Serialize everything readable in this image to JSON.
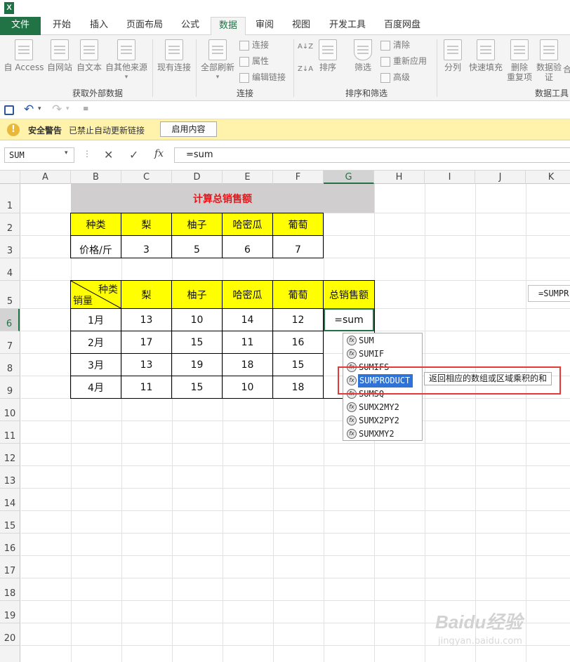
{
  "app": {
    "icon_letter": "X"
  },
  "tabs": [
    "文件",
    "开始",
    "插入",
    "页面布局",
    "公式",
    "数据",
    "审阅",
    "视图",
    "开发工具",
    "百度网盘"
  ],
  "ribbon": {
    "ext_data": [
      "自 Access",
      "自网站",
      "自文本",
      "自其他来源"
    ],
    "existing": "现有连接",
    "refresh_all": "全部刷新",
    "conn_small": [
      "连接",
      "属性",
      "编辑链接"
    ],
    "sort_az": "A↓Z",
    "sort_za": "Z↓A",
    "sort": "排序",
    "filter": "筛选",
    "filter_small": [
      "清除",
      "重新应用",
      "高级"
    ],
    "tools": [
      "分列",
      "快速填充",
      "删除",
      "重复项",
      "数据验",
      "证",
      "合"
    ],
    "groups": [
      "获取外部数据",
      "连接",
      "排序和筛选",
      "数据工具"
    ]
  },
  "security": {
    "title": "安全警告",
    "text": "已禁止自动更新链接",
    "button": "启用内容"
  },
  "formula_bar": {
    "name_box": "SUM",
    "fx": "fx",
    "value": "=sum"
  },
  "columns": [
    "A",
    "B",
    "C",
    "D",
    "E",
    "F",
    "G",
    "H",
    "I",
    "J",
    "K"
  ],
  "rows": [
    "1",
    "2",
    "3",
    "4",
    "5",
    "6",
    "7",
    "8",
    "9",
    "10",
    "11",
    "12",
    "13",
    "14",
    "15",
    "16",
    "17",
    "18",
    "19",
    "20"
  ],
  "sheet": {
    "title": "计算总销售额",
    "price_header": [
      "种类",
      "梨",
      "柚子",
      "哈密瓜",
      "葡萄"
    ],
    "price_row": [
      "价格/斤",
      "3",
      "5",
      "6",
      "7"
    ],
    "sales_header_top": "种类",
    "sales_header_bottom": "销量",
    "sales_header": [
      "梨",
      "柚子",
      "哈密瓜",
      "葡萄",
      "总销售额"
    ],
    "sales_rows": [
      [
        "1月",
        "13",
        "10",
        "14",
        "12",
        "=sum"
      ],
      [
        "2月",
        "17",
        "15",
        "11",
        "16",
        ""
      ],
      [
        "3月",
        "13",
        "19",
        "18",
        "15",
        ""
      ],
      [
        "4月",
        "11",
        "15",
        "10",
        "18",
        ""
      ]
    ]
  },
  "autocomplete": {
    "items": [
      "SUM",
      "SUMIF",
      "SUMIFS",
      "SUMPRODUCT",
      "SUMSQ",
      "SUMX2MY2",
      "SUMX2PY2",
      "SUMXMY2"
    ],
    "selected": "SUMPRODUCT",
    "tooltip": "返回相应的数组或区域乘积的和"
  },
  "side_hint": "=SUMPR",
  "watermark": {
    "brand": "Baidu经验",
    "url": "jingyan.baidu.com"
  },
  "colors": {
    "accent": "#217346",
    "highlight": "#ffff00",
    "title_red": "#e8161b",
    "selection": "#2f73d6",
    "annotation": "#e53935"
  }
}
